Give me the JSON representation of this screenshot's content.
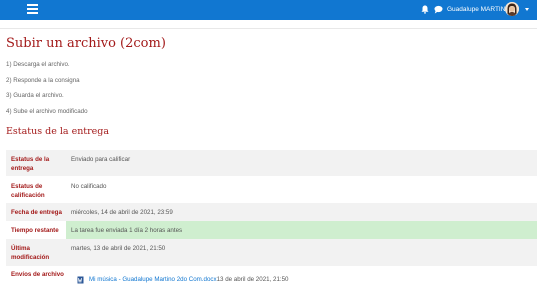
{
  "navbar": {
    "menu_icon": "hamburger-menu-icon",
    "notification_icon": "bell-icon",
    "messages_icon": "chat-icon",
    "user_name": "Guadalupe MARTINO",
    "brand_color": "#1177d1"
  },
  "page": {
    "title": "Subir un archivo (2com)",
    "steps": [
      "1) Descarga el archivo.",
      "2) Responde a la consigna",
      "3) Guarda el archivo.",
      "4) Sube el archivo modificado"
    ]
  },
  "submission": {
    "section_title": "Estatus de la entrega",
    "rows": [
      {
        "label": "Estatus de la entrega",
        "value": "Enviado para calificar"
      },
      {
        "label": "Estatus de calificación",
        "value": "No calificado"
      },
      {
        "label": "Fecha de entrega",
        "value": "miércoles, 14 de abril de 2021, 23:59"
      },
      {
        "label": "Tiempo restante",
        "value": "La tarea fue enviada 1 día 2 horas antes"
      },
      {
        "label": "Última modificación",
        "value": "martes, 13 de abril de 2021, 21:50"
      },
      {
        "label": "Envíos de archivo",
        "value": ""
      }
    ],
    "file": {
      "name": "Mi música - Guadalupe Martino 2do Com.docx",
      "date": "13 de abril de 2021, 21:50",
      "icon": "word-document-icon"
    },
    "accent_color": "#a31a1a",
    "highlight_color": "#cfeecf"
  }
}
